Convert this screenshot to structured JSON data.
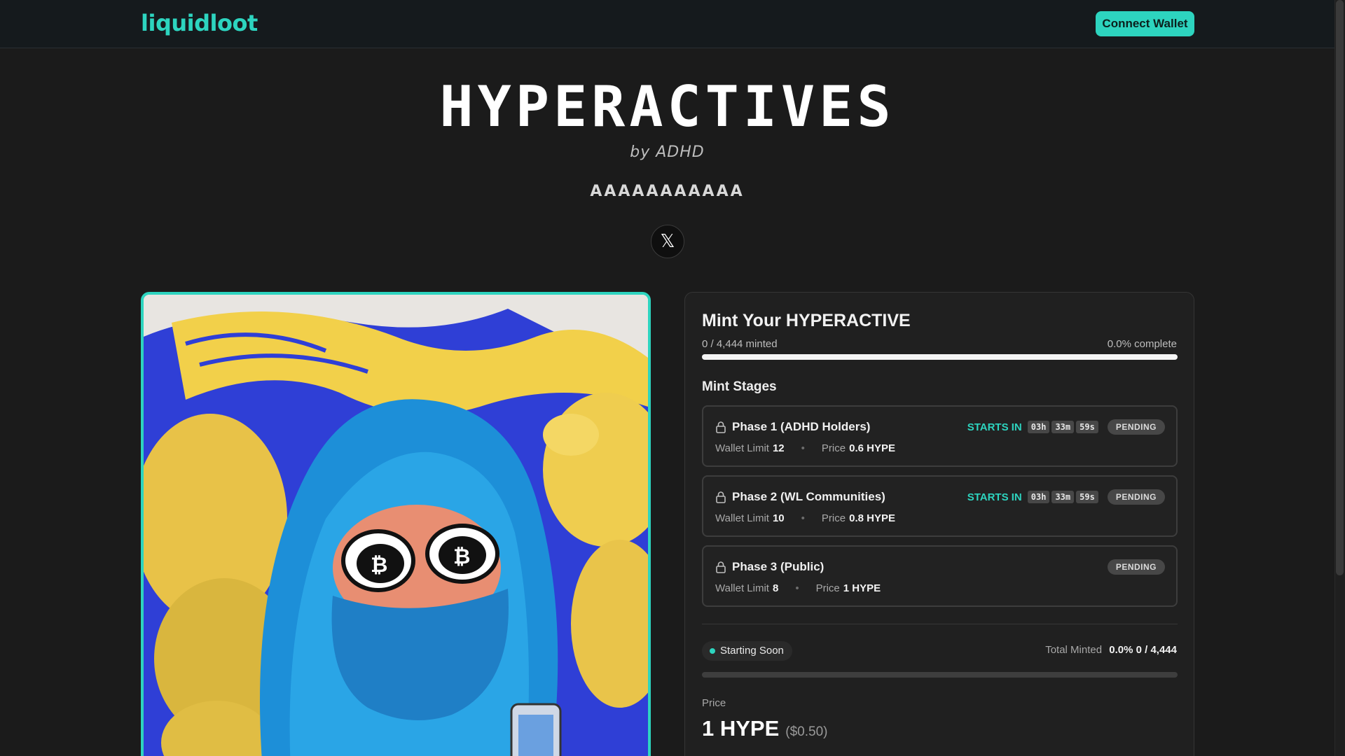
{
  "header": {
    "logo": "liquidloot",
    "connect_label": "Connect Wallet"
  },
  "hero": {
    "title": "HYPERACTIVES",
    "by": "by ADHD",
    "tagline": "AAAAAAAAAAA",
    "social_icon": "x-icon",
    "social_glyph": "𝕏"
  },
  "mint": {
    "title": "Mint Your HYPERACTIVE",
    "minted": "0 / 4,444 minted",
    "complete": "0.0% complete",
    "progress_fraction": 0,
    "stages_heading": "Mint Stages",
    "stages": [
      {
        "name": "Phase 1 (ADHD Holders)",
        "starts_in": "STARTS IN",
        "hours": "03h",
        "minutes": "33m",
        "seconds": "59s",
        "status": "PENDING",
        "wallet_label": "Wallet Limit",
        "wallet_limit": "12",
        "price_label": "Price",
        "price": "0.6 HYPE"
      },
      {
        "name": "Phase 2 (WL Communities)",
        "starts_in": "STARTS IN",
        "hours": "03h",
        "minutes": "33m",
        "seconds": "59s",
        "status": "PENDING",
        "wallet_label": "Wallet Limit",
        "wallet_limit": "10",
        "price_label": "Price",
        "price": "0.8 HYPE"
      },
      {
        "name": "Phase 3 (Public)",
        "status": "PENDING",
        "wallet_label": "Wallet Limit",
        "wallet_limit": "8",
        "price_label": "Price",
        "price": "1 HYPE"
      }
    ],
    "status_text": "Starting Soon",
    "total_minted_label": "Total Minted",
    "total_minted_value": "0.0% 0 / 4,444",
    "price_label": "Price",
    "price_value": "1 HYPE",
    "price_usd": "($0.50)"
  },
  "colors": {
    "accent": "#2dd4bf",
    "background": "#1b1b1b",
    "panel": "#202020"
  }
}
